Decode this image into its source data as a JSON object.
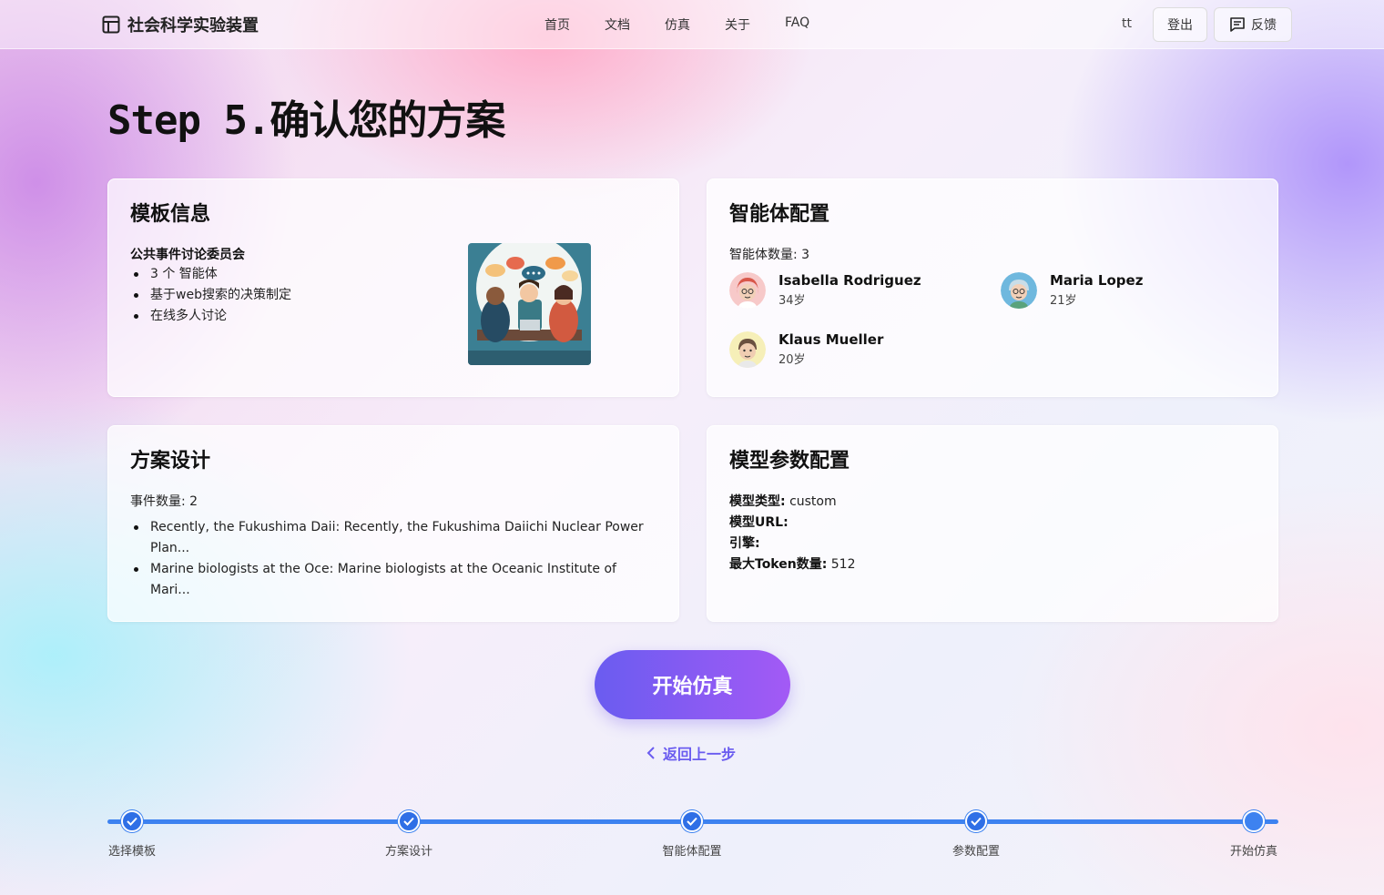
{
  "app": {
    "title": "社会科学实验装置"
  },
  "nav": {
    "home": "首页",
    "docs": "文档",
    "sim": "仿真",
    "about": "关于",
    "faq": "FAQ"
  },
  "user": {
    "name": "tt",
    "logout": "登出",
    "feedback": "反馈"
  },
  "page": {
    "title": "Step 5.确认您的方案"
  },
  "template": {
    "heading": "模板信息",
    "name": "公共事件讨论委员会",
    "features": [
      "3 个 智能体",
      "基于web搜索的决策制定",
      "在线多人讨论"
    ]
  },
  "agents": {
    "heading": "智能体配置",
    "count_label": "智能体数量: 3",
    "list": [
      {
        "name": "Isabella Rodriguez",
        "age": "34岁"
      },
      {
        "name": "Maria Lopez",
        "age": "21岁"
      },
      {
        "name": "Klaus Mueller",
        "age": "20岁"
      }
    ]
  },
  "scenario": {
    "heading": "方案设计",
    "count_label": "事件数量: 2",
    "events": [
      "Recently, the Fukushima Daii: Recently, the Fukushima Daiichi Nuclear Power Plan...",
      "Marine biologists at the Oce: Marine biologists at the Oceanic Institute of Mari..."
    ]
  },
  "model": {
    "heading": "模型参数配置",
    "type_label": "模型类型:",
    "type_value": "custom",
    "url_label": "模型URL:",
    "url_value": "",
    "engine_label": "引擎:",
    "engine_value": "",
    "tokens_label": "最大Token数量:",
    "tokens_value": "512"
  },
  "actions": {
    "start": "开始仿真",
    "back": "返回上一步"
  },
  "steps": [
    "选择模板",
    "方案设计",
    "智能体配置",
    "参数配置",
    "开始仿真"
  ],
  "colors": {
    "accent_start": "#6a5cf0",
    "accent_end": "#a35af5",
    "progress": "#3d82f0"
  }
}
